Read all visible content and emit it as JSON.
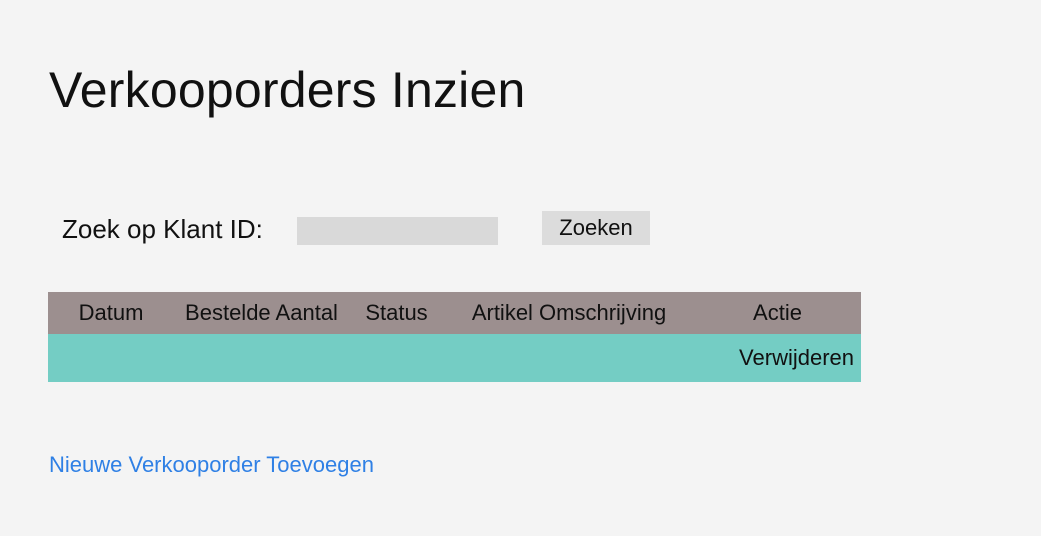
{
  "page": {
    "title": "Verkooporders Inzien"
  },
  "search": {
    "label": "Zoek op Klant ID:",
    "value": "",
    "placeholder": "",
    "button_label": "Zoeken"
  },
  "table": {
    "columns": [
      "Datum",
      "Bestelde Aantal",
      "Status",
      "Artikel Omschrijving",
      "Actie"
    ],
    "rows": [
      {
        "datum": "",
        "bestelde_aantal": "",
        "status": "",
        "artikel_omschrijving": "",
        "actie": "Verwijderen"
      }
    ],
    "header_color": "#9c8f8f",
    "row_color": "#74cdc4"
  },
  "footer": {
    "add_link_label": "Nieuwe Verkooporder Toevoegen",
    "link_color": "#2f80e5"
  }
}
